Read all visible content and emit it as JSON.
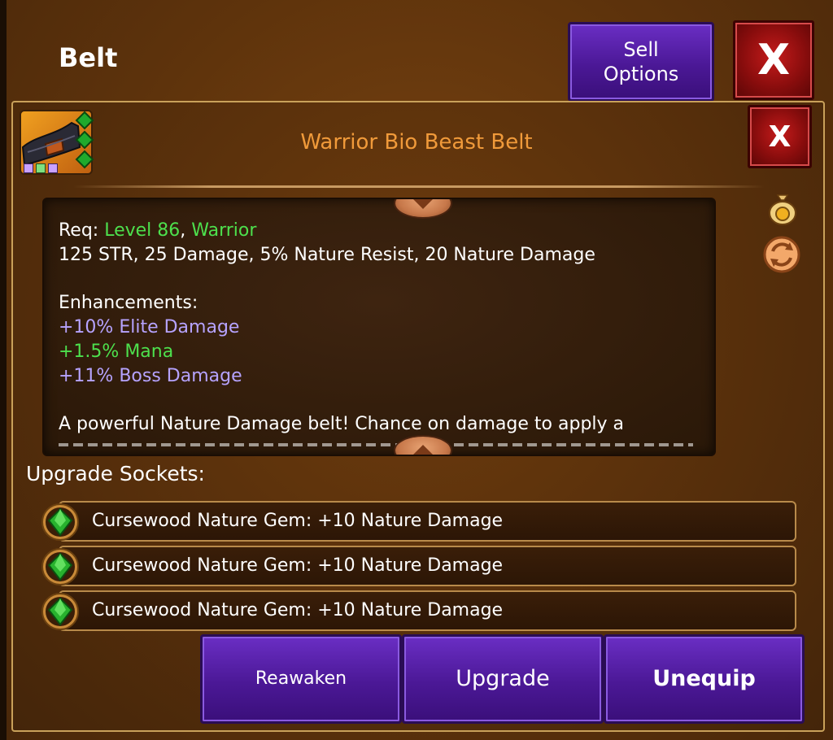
{
  "window": {
    "title": "Belt",
    "sell_options_label": "Sell\nOptions",
    "close_label": "X"
  },
  "item": {
    "name": "Warrior Bio Beast Belt",
    "close_label": "X",
    "icon": "belt-icon",
    "gem_slot_icons": [
      "green-gem-icon",
      "green-gem-icon",
      "green-gem-icon"
    ],
    "rank_pips": [
      "#c9a2ff",
      "#7fe07f",
      "#c9a2ff"
    ]
  },
  "description": {
    "req_prefix": "Req: ",
    "req_level": "Level 86",
    "req_sep": ", ",
    "req_class": "Warrior",
    "stats": "125 STR, 25 Damage, 5% Nature Resist, 20 Nature Damage",
    "enh_heading": "Enhancements:",
    "enhancements": [
      {
        "text": "+10% Elite Damage",
        "color": "#b6a3ff"
      },
      {
        "text": "+1.5% Mana",
        "color": "#4de04d"
      },
      {
        "text": "+11% Boss Damage",
        "color": "#b6a3ff"
      }
    ],
    "flavor": "A powerful Nature Damage belt! Chance on damage to apply a"
  },
  "side_icons": [
    "gold-bag-icon",
    "swap-icon"
  ],
  "sockets": {
    "label": "Upgrade Sockets:",
    "rows": [
      {
        "icon": "nature-gem-icon",
        "text": "Cursewood Nature Gem: +10 Nature Damage"
      },
      {
        "icon": "nature-gem-icon",
        "text": "Cursewood Nature Gem: +10 Nature Damage"
      },
      {
        "icon": "nature-gem-icon",
        "text": "Cursewood Nature Gem: +10 Nature Damage"
      }
    ]
  },
  "actions": {
    "reawaken": "Reawaken",
    "upgrade": "Upgrade",
    "unequip": "Unequip"
  },
  "colors": {
    "item_name": "#f09a3a",
    "requirement_green": "#4de04d",
    "enhancement_purple": "#b6a3ff",
    "button_purple": "#4b1896",
    "button_red": "#8a0d0d"
  }
}
